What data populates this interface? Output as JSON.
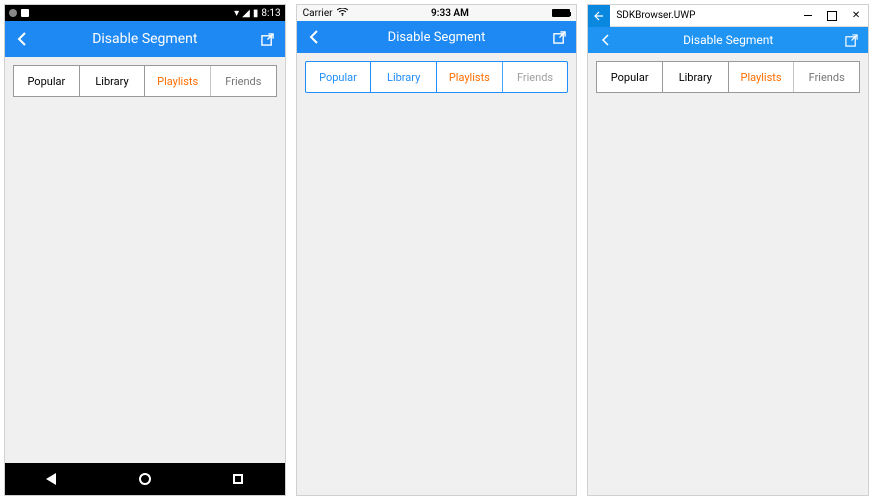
{
  "android": {
    "status": {
      "time": "8:13"
    },
    "header": {
      "title": "Disable Segment"
    },
    "segments": [
      {
        "label": "Popular"
      },
      {
        "label": "Library"
      },
      {
        "label": "Playlists"
      },
      {
        "label": "Friends"
      }
    ]
  },
  "ios": {
    "status": {
      "carrier": "Carrier",
      "time": "9:33 AM"
    },
    "header": {
      "title": "Disable Segment"
    },
    "segments": [
      {
        "label": "Popular"
      },
      {
        "label": "Library"
      },
      {
        "label": "Playlists"
      },
      {
        "label": "Friends"
      }
    ]
  },
  "uwp": {
    "titlebar": {
      "appname": "SDKBrowser.UWP"
    },
    "header": {
      "title": "Disable Segment"
    },
    "segments": [
      {
        "label": "Popular"
      },
      {
        "label": "Library"
      },
      {
        "label": "Playlists"
      },
      {
        "label": "Friends"
      }
    ]
  }
}
